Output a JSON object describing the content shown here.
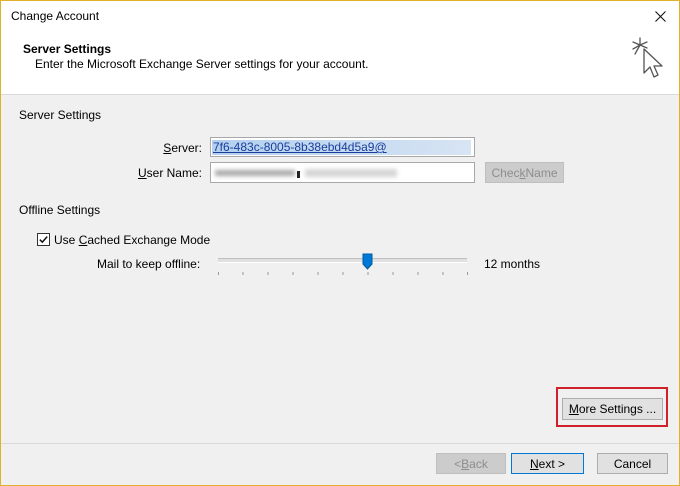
{
  "window": {
    "title": "Change Account"
  },
  "header": {
    "title": "Server Settings",
    "subtitle": "Enter the Microsoft Exchange Server settings for your account.",
    "icon": "cursor-click-icon"
  },
  "server_settings": {
    "section_label": "Server Settings",
    "server_label_pre": "",
    "server_label_accel": "S",
    "server_label_post": "erver:",
    "server_value": "7f6-483c-8005-8b38ebd4d5a9@",
    "user_label_pre": "",
    "user_label_accel": "U",
    "user_label_post": "ser Name:",
    "check_name_pre": "Chec",
    "check_name_accel": "k",
    "check_name_post": " Name"
  },
  "offline_settings": {
    "section_label": "Offline Settings",
    "cached_mode_pre": "Use ",
    "cached_mode_accel": "C",
    "cached_mode_post": "ached Exchange Mode",
    "cached_mode_checked": true,
    "mail_keep_label": "Mail to keep offline:",
    "mail_keep_value": "12 months"
  },
  "buttons": {
    "more_settings_accel": "M",
    "more_settings_post": "ore Settings ...",
    "back_pre": "< ",
    "back_accel": "B",
    "back_post": "ack",
    "next_accel": "N",
    "next_post": "ext >",
    "cancel": "Cancel"
  },
  "colors": {
    "highlight_border": "#d0202b",
    "accent": "#0078d7"
  }
}
